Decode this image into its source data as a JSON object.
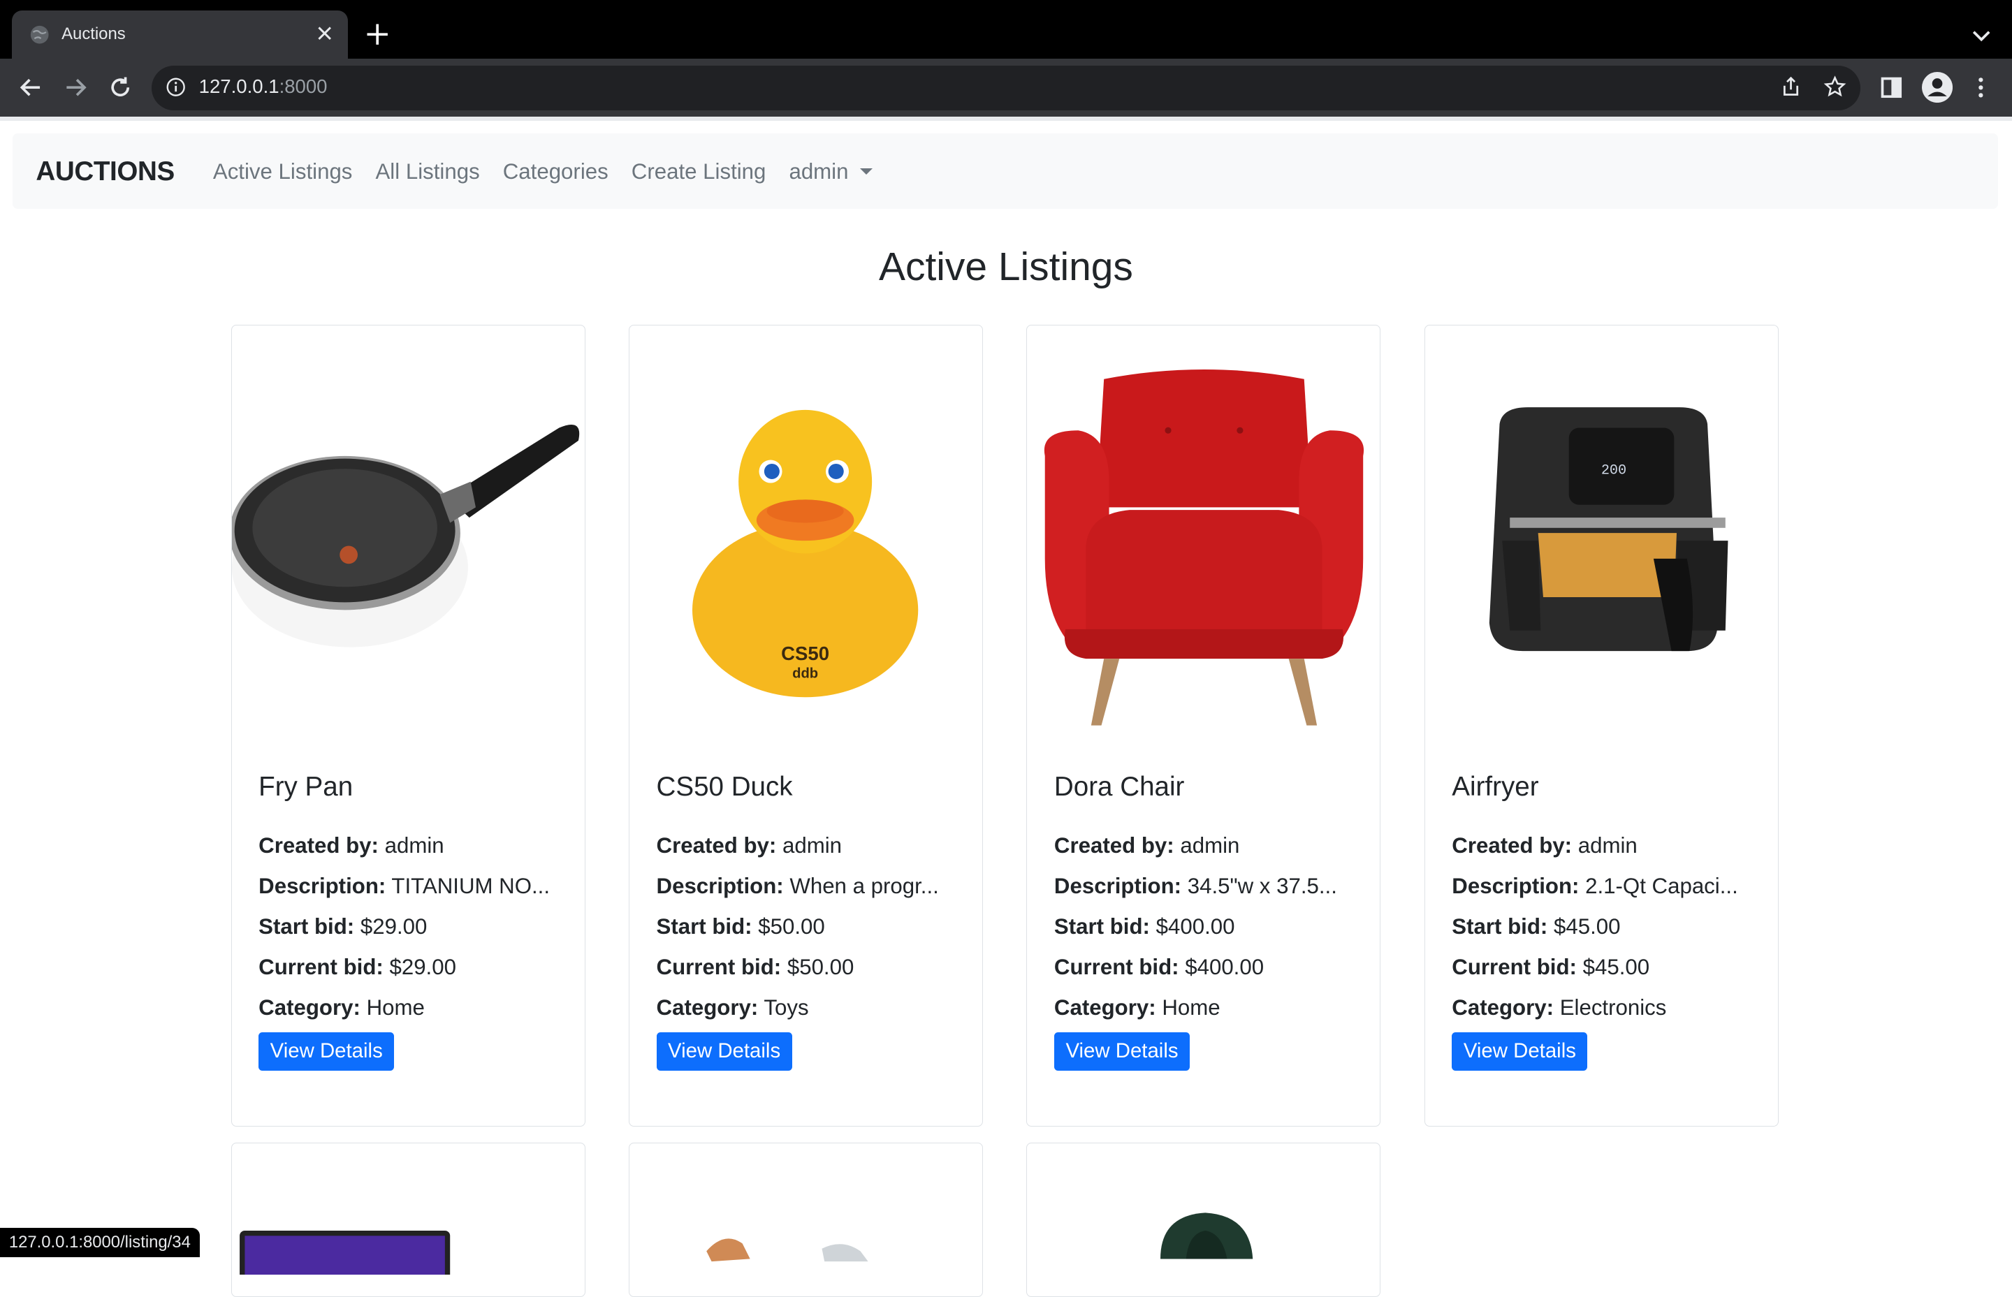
{
  "browser": {
    "tab_title": "Auctions",
    "url_host": "127.0.0.1",
    "url_port": ":8000",
    "status_url": "127.0.0.1:8000/listing/34"
  },
  "navbar": {
    "brand": "AUCTIONS",
    "links": [
      "Active Listings",
      "All Listings",
      "Categories",
      "Create Listing"
    ],
    "user": "admin"
  },
  "page": {
    "title": "Active Listings"
  },
  "labels": {
    "created_by": "Created by:",
    "description": "Description:",
    "start_bid": "Start bid:",
    "current_bid": "Current bid:",
    "category": "Category:",
    "view_details": "View Details"
  },
  "listings": [
    {
      "title": "Fry Pan",
      "created_by": "admin",
      "description": "TITANIUM NO...",
      "start_bid": "$29.00",
      "current_bid": "$29.00",
      "category": "Home",
      "image": "frying-pan"
    },
    {
      "title": "CS50 Duck",
      "created_by": "admin",
      "description": "When a progr...",
      "start_bid": "$50.00",
      "current_bid": "$50.00",
      "category": "Toys",
      "image": "rubber-duck",
      "image_text": "CS50",
      "image_subtext": "ddb"
    },
    {
      "title": "Dora Chair",
      "created_by": "admin",
      "description": "34.5\"w x 37.5...",
      "start_bid": "$400.00",
      "current_bid": "$400.00",
      "category": "Home",
      "image": "armchair"
    },
    {
      "title": "Airfryer",
      "created_by": "admin",
      "description": "2.1-Qt Capaci...",
      "start_bid": "$45.00",
      "current_bid": "$45.00",
      "category": "Electronics",
      "image": "air-fryer",
      "image_text": "200"
    }
  ],
  "partial_listings": [
    "laptop",
    "shoes",
    "hoodie"
  ],
  "colors": {
    "primary": "#0d6efd",
    "navbar_bg": "#f8f9fa",
    "chrome_dark": "#35363a"
  }
}
